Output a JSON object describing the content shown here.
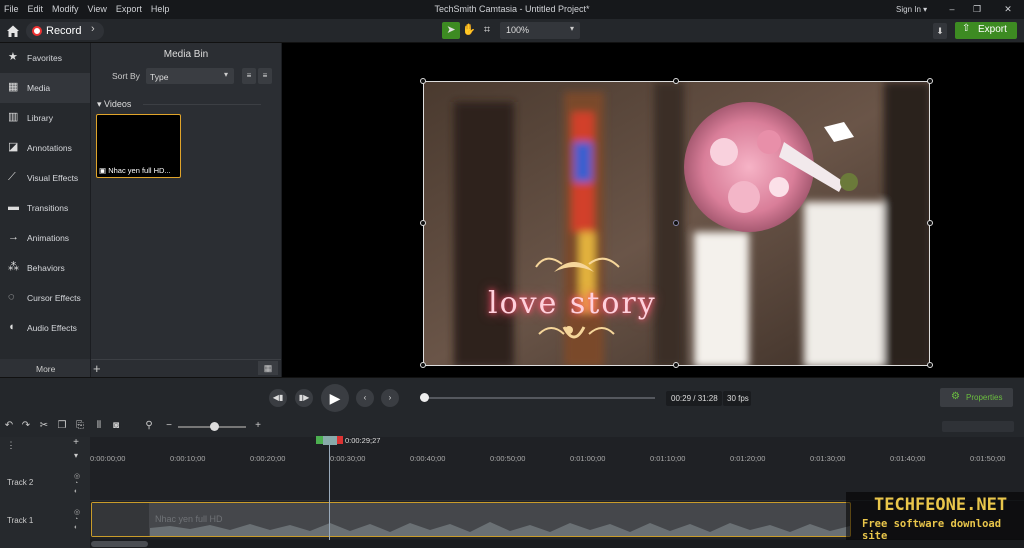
{
  "window": {
    "title": "TechSmith Camtasia - Untitled Project*",
    "menu": [
      "File",
      "Edit",
      "Modify",
      "View",
      "Export",
      "Help"
    ],
    "sign_in": "Sign In ▾"
  },
  "toolbar": {
    "record_label": "Record",
    "zoom": "100%",
    "export_label": "Export"
  },
  "sidebar": {
    "items": [
      {
        "label": "Favorites",
        "icon": "star-icon"
      },
      {
        "label": "Media",
        "icon": "film-icon"
      },
      {
        "label": "Library",
        "icon": "library-icon"
      },
      {
        "label": "Annotations",
        "icon": "annotation-icon"
      },
      {
        "label": "Visual Effects",
        "icon": "wand-icon"
      },
      {
        "label": "Transitions",
        "icon": "transition-icon"
      },
      {
        "label": "Animations",
        "icon": "animation-icon"
      },
      {
        "label": "Behaviors",
        "icon": "behavior-icon"
      },
      {
        "label": "Cursor Effects",
        "icon": "cursor-icon"
      },
      {
        "label": "Audio Effects",
        "icon": "audio-icon"
      }
    ],
    "more_label": "More"
  },
  "media_bin": {
    "title": "Media Bin",
    "sort_by_label": "Sort By",
    "sort_value": "Type",
    "section": "Videos",
    "clip_name": "Nhac yen full HD..."
  },
  "canvas": {
    "overlay_text": "love story"
  },
  "playback": {
    "time": "00:29 / 31:28",
    "fps": "30 fps",
    "properties_label": "Properties",
    "progress_fraction": 0.015
  },
  "timeline": {
    "playhead_time": "0:00:29;27",
    "ticks": [
      "0:00:00;00",
      "0:00:10;00",
      "0:00:20;00",
      "0:00:30;00",
      "0:00:40;00",
      "0:00:50;00",
      "0:01:00;00",
      "0:01:10;00",
      "0:01:20;00",
      "0:01:30;00",
      "0:01:40;00",
      "0:01:50;00"
    ],
    "tracks": [
      {
        "label": "Track 2"
      },
      {
        "label": "Track 1",
        "clip": "Nhac yen full HD"
      }
    ]
  },
  "watermark": {
    "line1": "TECHFEONE.NET",
    "line2": "Free software download site"
  },
  "colors": {
    "accent_green": "#3d8b22",
    "clip_border": "#e0a42a",
    "record_red": "#e33333"
  }
}
